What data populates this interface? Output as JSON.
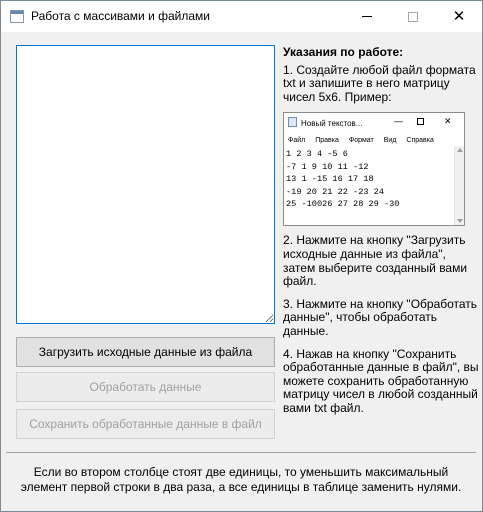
{
  "window": {
    "title": "Работа с массивами и файлами"
  },
  "buttons": {
    "load": "Загрузить исходные данные из файла",
    "process": "Обработать данные",
    "save": "Сохранить обработанные данные в файл"
  },
  "instructions": {
    "heading": "Указания по работе:",
    "step1": "1. Создайте любой файл формата txt и запишите в него матрицу чисел 5х6. Пример:",
    "step2": "2. Нажмите на кнопку \"Загрузить исходные данные из файла\", затем выберите созданный вами файл.",
    "step3": "3. Нажмите на кнопку \"Обработать данные\", чтобы обработать данные.",
    "step4": "4. Нажав на кнопку \"Сохранить обработанные данные в файл\", вы можете сохранить обработанную матрицу чисел в любой созданный вами txt файл."
  },
  "notepad_example": {
    "title": "Новый текстов...",
    "menu": [
      "Файл",
      "Правка",
      "Формат",
      "Вид",
      "Справка"
    ],
    "content": "1 2 3 4 -5 6\n-7 1 9 10 11 -12\n13 1 -15 16 17 18\n-19 20 21 22 -23 24\n25 -10026 27 28 29 -30"
  },
  "task": {
    "text": "Если во втором столбце стоят две единицы, то уменьшить максимальный элемент первой строки в два раза, а все единицы в таблице заменить нулями."
  }
}
